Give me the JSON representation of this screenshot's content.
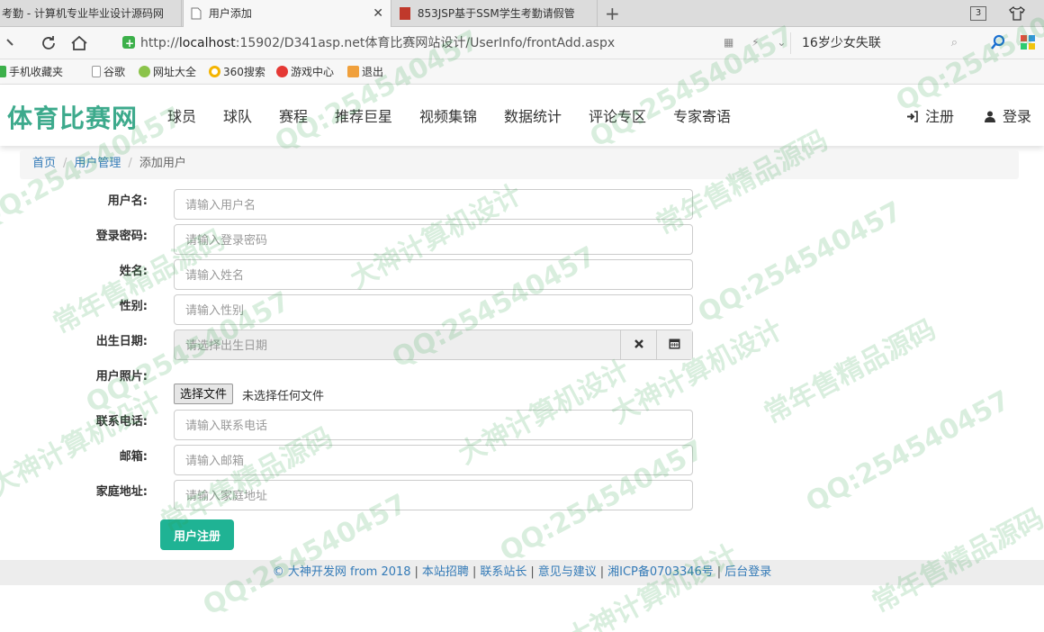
{
  "browser": {
    "tabs": [
      {
        "title": "考勤 - 计算机专业毕业设计源码网"
      },
      {
        "title": "用户添加",
        "active": true
      },
      {
        "title": "853JSP基于SSM学生考勤请假管"
      }
    ],
    "tab_count": "3",
    "url_prefix": "http://",
    "url_host": "localhost",
    "url_rest": ":15902/D341asp.net体育比赛网站设计/UserInfo/frontAdd.aspx",
    "search_text": "16岁少女失联",
    "bookmarks": [
      "手机收藏夹",
      "谷歌",
      "网址大全",
      "360搜索",
      "游戏中心",
      "退出"
    ]
  },
  "site": {
    "logo": "体育比赛网",
    "menu": [
      "球员",
      "球队",
      "赛程",
      "推荐巨星",
      "视频集锦",
      "数据统计",
      "评论专区",
      "专家寄语"
    ],
    "register": "注册",
    "login": "登录"
  },
  "breadcrumb": {
    "home": "首页",
    "section": "用户管理",
    "current": "添加用户"
  },
  "form": {
    "username": {
      "label": "用户名:",
      "placeholder": "请输入用户名"
    },
    "password": {
      "label": "登录密码:",
      "placeholder": "请输入登录密码"
    },
    "name": {
      "label": "姓名:",
      "placeholder": "请输入姓名"
    },
    "gender": {
      "label": "性别:",
      "placeholder": "请输入性别"
    },
    "birthday": {
      "label": "出生日期:",
      "placeholder": "请选择出生日期"
    },
    "photo": {
      "label": "用户照片:",
      "button": "选择文件",
      "status": "未选择任何文件"
    },
    "phone": {
      "label": "联系电话:",
      "placeholder": "请输入联系电话"
    },
    "email": {
      "label": "邮箱:",
      "placeholder": "请输入邮箱"
    },
    "address": {
      "label": "家庭地址:",
      "placeholder": "请输入家庭地址"
    },
    "submit": "用户注册"
  },
  "footer": {
    "links": [
      "© 大神开发网 from 2018",
      "本站招聘",
      "联系站长",
      "意见与建议",
      "湘ICP备0703346号",
      "后台登录"
    ]
  },
  "watermark": [
    "QQ:254540457",
    "大神计算机设计",
    "常年售精品源码"
  ],
  "colors": {
    "accent": "#1fb394",
    "logo": "#3daa8c",
    "link": "#337ab7",
    "watermark": "#2ea046"
  }
}
